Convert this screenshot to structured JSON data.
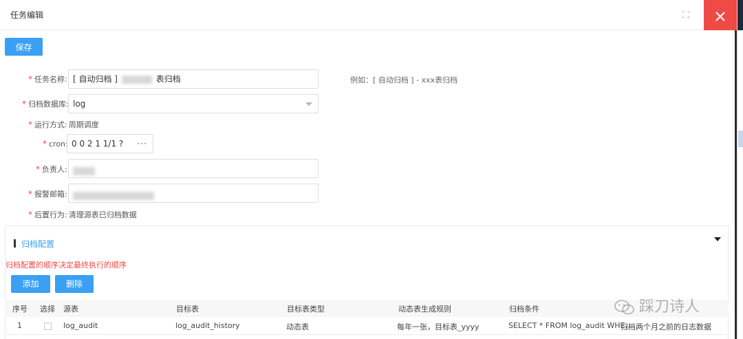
{
  "dialog": {
    "title": "任务编辑",
    "maximize_icon": "maximize-icon",
    "close_icon": "close-icon"
  },
  "toolbar": {
    "save_label": "保存"
  },
  "form": {
    "task_name": {
      "label": "任务名称:",
      "value_prefix": "[ 自动归档 ]",
      "value_suffix": "表归档",
      "hint": "例如：[ 自动归档 ] - xxx表归档"
    },
    "archive_db": {
      "label": "归档数据库:",
      "value": "log"
    },
    "run_mode": {
      "label": "运行方式:",
      "value": "周期调度"
    },
    "cron": {
      "label": "cron:",
      "value": "0 0 2 1 1/1 ?",
      "more": "···"
    },
    "owner": {
      "label": "负责人:"
    },
    "alert_email": {
      "label": "报警邮箱:"
    },
    "post_action": {
      "label": "后置行为:",
      "value": "清理源表已归档数据"
    }
  },
  "archive_config": {
    "title": "归档配置",
    "warning": "归档配置的顺序决定最终执行的顺序",
    "add_label": "添加",
    "delete_label": "删除",
    "columns": [
      "序号",
      "选择",
      "源表",
      "目标表",
      "目标表类型",
      "动态表生成规则",
      "归档条件"
    ],
    "rows": [
      {
        "index": "1",
        "source": "log_audit",
        "target": "log_audit_history",
        "target_type": "动态表",
        "rule": "每年一张，目标表_yyyy",
        "condition": "SELECT * FROM log_audit WHE…",
        "note": "归档两个月之前的日志数据"
      }
    ]
  },
  "watermark": {
    "text": "踩刀诗人"
  },
  "colors": {
    "accent": "#3aa0f3",
    "danger": "#f04a47"
  }
}
